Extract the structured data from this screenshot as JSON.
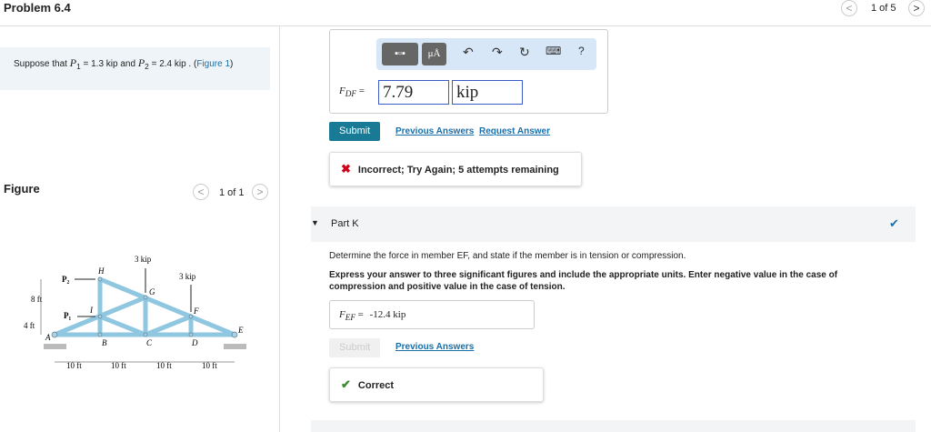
{
  "header": {
    "title": "Problem 6.4",
    "pager": "1 of 5",
    "prev": "<",
    "next": ">"
  },
  "prompt": {
    "text1": "Suppose that ",
    "p1": "P",
    "p1sub": "1",
    "eq1": " = 1.3 kip and ",
    "p2": "P",
    "p2sub": "2",
    "eq2": " = 2.4 kip . (",
    "link": "Figure 1",
    ")": ")"
  },
  "figure": {
    "label": "Figure",
    "pager": "1 of 1",
    "prev": "<",
    "next": ">",
    "labels": {
      "load1": "3 kip",
      "load2": "3 kip",
      "H": "H",
      "G": "G",
      "F": "F",
      "E": "E",
      "I": "I",
      "A": "A",
      "B": "B",
      "C": "C",
      "D": "D",
      "P1": "P₁",
      "P2": "P₂",
      "h1": "8 ft",
      "h2": "4 ft",
      "w1": "10 ft",
      "w2": "10 ft",
      "w3": "10 ft",
      "w4": "10 ft"
    }
  },
  "partj": {
    "label": "F",
    "sub": "DF",
    "eq": "=",
    "value": "7.79",
    "units": "kip",
    "toolbar": {
      "units_btn": "μÅ",
      "undo": "↶",
      "redo": "↷",
      "reset": "↻",
      "keyboard": "⌨",
      "help": "?"
    },
    "submit": "Submit",
    "previous": "Previous Answers",
    "request": "Request Answer",
    "feedback_icon": "✖",
    "feedback": "Incorrect; Try Again; 5 attempts remaining"
  },
  "partk": {
    "title": "Part K",
    "check": "✔",
    "question": "Determine the force in member EF, and state if the member is in tension or compression.",
    "instructions": "Express your answer to three significant figures and include the appropriate units. Enter negative value in the case of compression and positive value in the case of tension.",
    "label": "F",
    "sub": "EF",
    "eq": "=",
    "answer": "-12.4 kip",
    "submit": "Submit",
    "previous": "Previous Answers",
    "feedback_icon": "✔",
    "feedback": "Correct"
  },
  "colors": {
    "accent": "#187a95",
    "error": "#d0021b",
    "success": "#3c8a2e",
    "member": "#8fc6e0"
  }
}
